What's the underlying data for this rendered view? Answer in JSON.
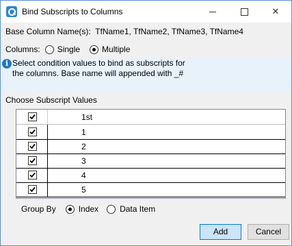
{
  "window": {
    "title": "Bind Subscripts to Columns"
  },
  "base": {
    "label": "Base Column Name(s):",
    "value": "TfName1, TfName2, TfName3, TfName4"
  },
  "columns": {
    "label": "Columns:",
    "options": [
      "Single",
      "Multiple"
    ],
    "selected": "Multiple"
  },
  "info": {
    "text": "Select condition values to bind as subscripts for the columns. Base name will appended with _#"
  },
  "subscripts": {
    "label": "Choose Subscript Values",
    "header": "1st",
    "rows": [
      {
        "value": "1",
        "checked": true
      },
      {
        "value": "2",
        "checked": true
      },
      {
        "value": "3",
        "checked": true
      },
      {
        "value": "4",
        "checked": true
      },
      {
        "value": "5",
        "checked": true
      }
    ]
  },
  "groupby": {
    "label": "Group By",
    "options": [
      "Index",
      "Data Item"
    ],
    "selected": "Index"
  },
  "buttons": {
    "add": "Add",
    "cancel": "Cancel"
  }
}
